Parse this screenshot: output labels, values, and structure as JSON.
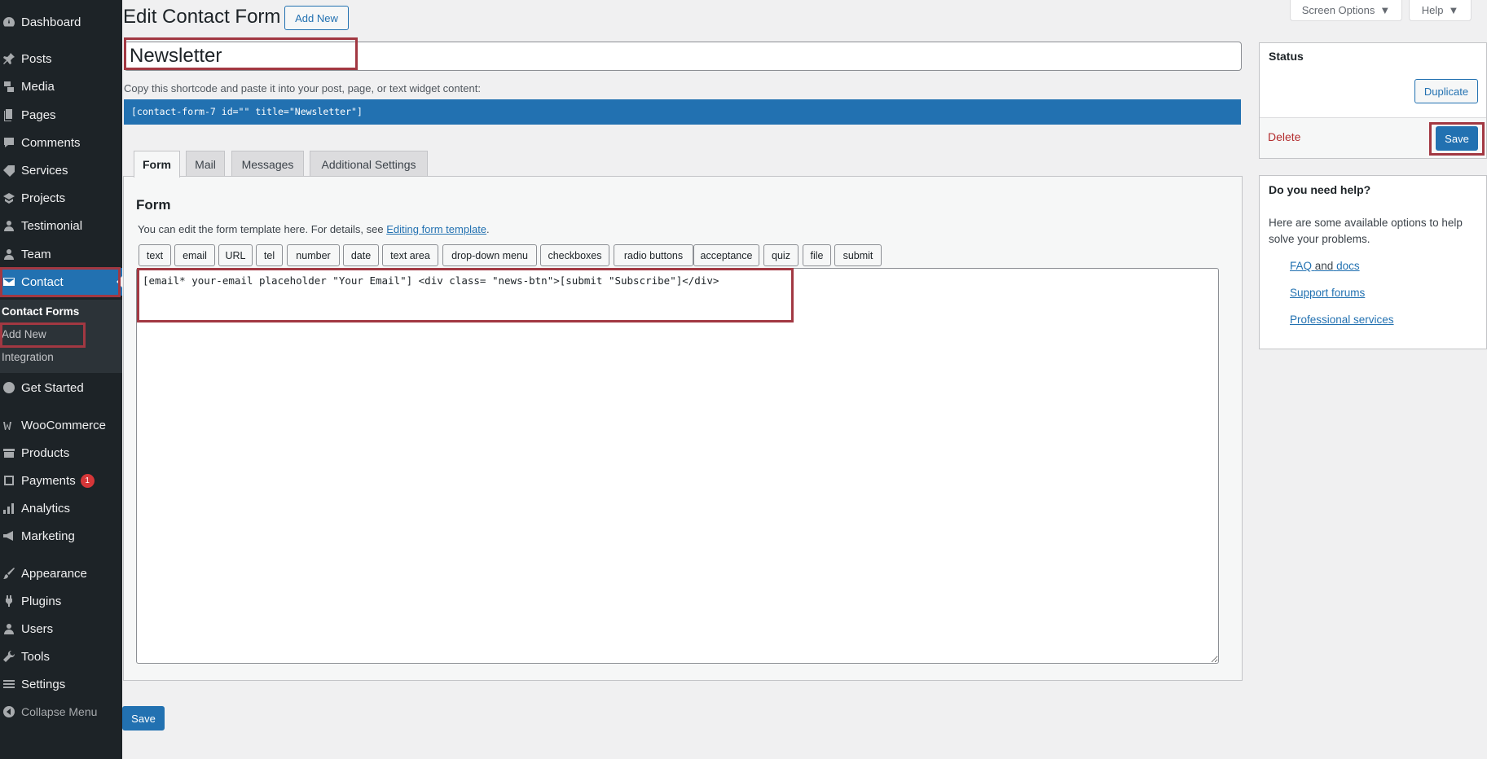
{
  "sidebar": {
    "items": [
      {
        "label": "Dashboard",
        "icon": "dashboard-icon"
      },
      {
        "label": "Posts",
        "icon": "pin-icon"
      },
      {
        "label": "Media",
        "icon": "media-icon"
      },
      {
        "label": "Pages",
        "icon": "pages-icon"
      },
      {
        "label": "Comments",
        "icon": "comment-icon"
      },
      {
        "label": "Services",
        "icon": "services-icon"
      },
      {
        "label": "Projects",
        "icon": "projects-icon"
      },
      {
        "label": "Testimonial",
        "icon": "user-icon"
      },
      {
        "label": "Team",
        "icon": "user-icon"
      },
      {
        "label": "Contact",
        "icon": "mail-icon"
      },
      {
        "label": "Get Started",
        "icon": "gauge-icon"
      },
      {
        "label": "WooCommerce",
        "icon": "woo-icon"
      },
      {
        "label": "Products",
        "icon": "archive-icon"
      },
      {
        "label": "Payments",
        "icon": "dollar-icon",
        "badge": "1"
      },
      {
        "label": "Analytics",
        "icon": "bar-chart-icon"
      },
      {
        "label": "Marketing",
        "icon": "megaphone-icon"
      },
      {
        "label": "Appearance",
        "icon": "brush-icon"
      },
      {
        "label": "Plugins",
        "icon": "plug-icon"
      },
      {
        "label": "Users",
        "icon": "users-icon"
      },
      {
        "label": "Tools",
        "icon": "wrench-icon"
      },
      {
        "label": "Settings",
        "icon": "settings-icon"
      },
      {
        "label": "Collapse Menu",
        "icon": "collapse-icon"
      }
    ],
    "submenu": [
      "Contact Forms",
      "Add New",
      "Integration"
    ]
  },
  "header": {
    "title": "Edit Contact Form",
    "add_new": "Add New",
    "screen_options": "Screen Options",
    "help": "Help"
  },
  "form": {
    "title_value": "Newsletter",
    "shortcode_label": "Copy this shortcode and paste it into your post, page, or text widget content:",
    "shortcode": "[contact-form-7 id=\"\" title=\"Newsletter\"]",
    "tabs": [
      "Form",
      "Mail",
      "Messages",
      "Additional Settings"
    ],
    "panel_heading": "Form",
    "panel_desc": "You can edit the form template here. For details, see ",
    "panel_link": "Editing form template",
    "panel_desc_end": ".",
    "tag_buttons": [
      "text",
      "email",
      "URL",
      "tel",
      "number",
      "date",
      "text area",
      "drop-down menu",
      "checkboxes",
      "radio buttons",
      "acceptance",
      "quiz",
      "file",
      "submit"
    ],
    "template": "[email* your-email placeholder \"Your Email\"] <div class= \"news-btn\">[submit \"Subscribe\"]</div>",
    "save_label": "Save"
  },
  "status_box": {
    "title": "Status",
    "duplicate": "Duplicate",
    "delete": "Delete",
    "save": "Save"
  },
  "help_box": {
    "title": "Do you need help?",
    "text": "Here are some available options to help solve your problems.",
    "faq": "FAQ",
    "and": "and",
    "docs": "docs",
    "support": "Support forums",
    "professional": "Professional services"
  },
  "colors": {
    "sidebar_bg": "#1d2327",
    "accent": "#2271b1",
    "highlight_border": "#a23842",
    "delete": "#b32d2e"
  }
}
